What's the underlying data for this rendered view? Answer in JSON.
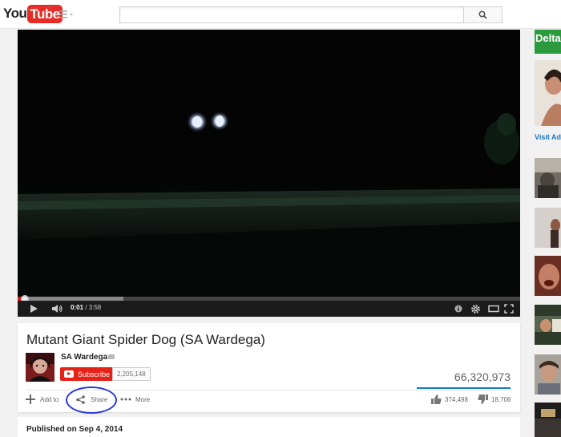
{
  "masthead": {
    "logo_you": "You",
    "logo_tube": "Tube",
    "logo_country": "IL",
    "search_placeholder": "",
    "guide_icon": "menu-icon",
    "search_icon": "search-icon"
  },
  "player": {
    "progress_played_fraction": 0.0028,
    "progress_loaded_fraction": 0.21,
    "time_current": "0:01",
    "time_separator": " / ",
    "time_total": "3:58",
    "icons": [
      "play-icon",
      "volume-icon",
      "info-icon",
      "gear-icon",
      "theater-icon",
      "fullscreen-icon"
    ]
  },
  "video": {
    "title": "Mutant Giant Spider Dog (SA Wardega)",
    "channel": "SA Wardega",
    "subscribe_label": "Subscribe",
    "subscriber_count": "2,205,148",
    "views": "66,320,973",
    "actions": {
      "add_to": "Add to",
      "share": "Share",
      "more": "More"
    },
    "likes": "374,498",
    "dislikes": "18,706",
    "published": "Published on Sep 4, 2014"
  },
  "sidebar": {
    "ad_brand": "Delta",
    "visit_ad": "Visit Ad"
  },
  "colors": {
    "brand_red": "#e52d27",
    "subscribe_red": "#e62117",
    "link_blue": "#167ac6",
    "annotation_circle": "#2a3ad0"
  }
}
